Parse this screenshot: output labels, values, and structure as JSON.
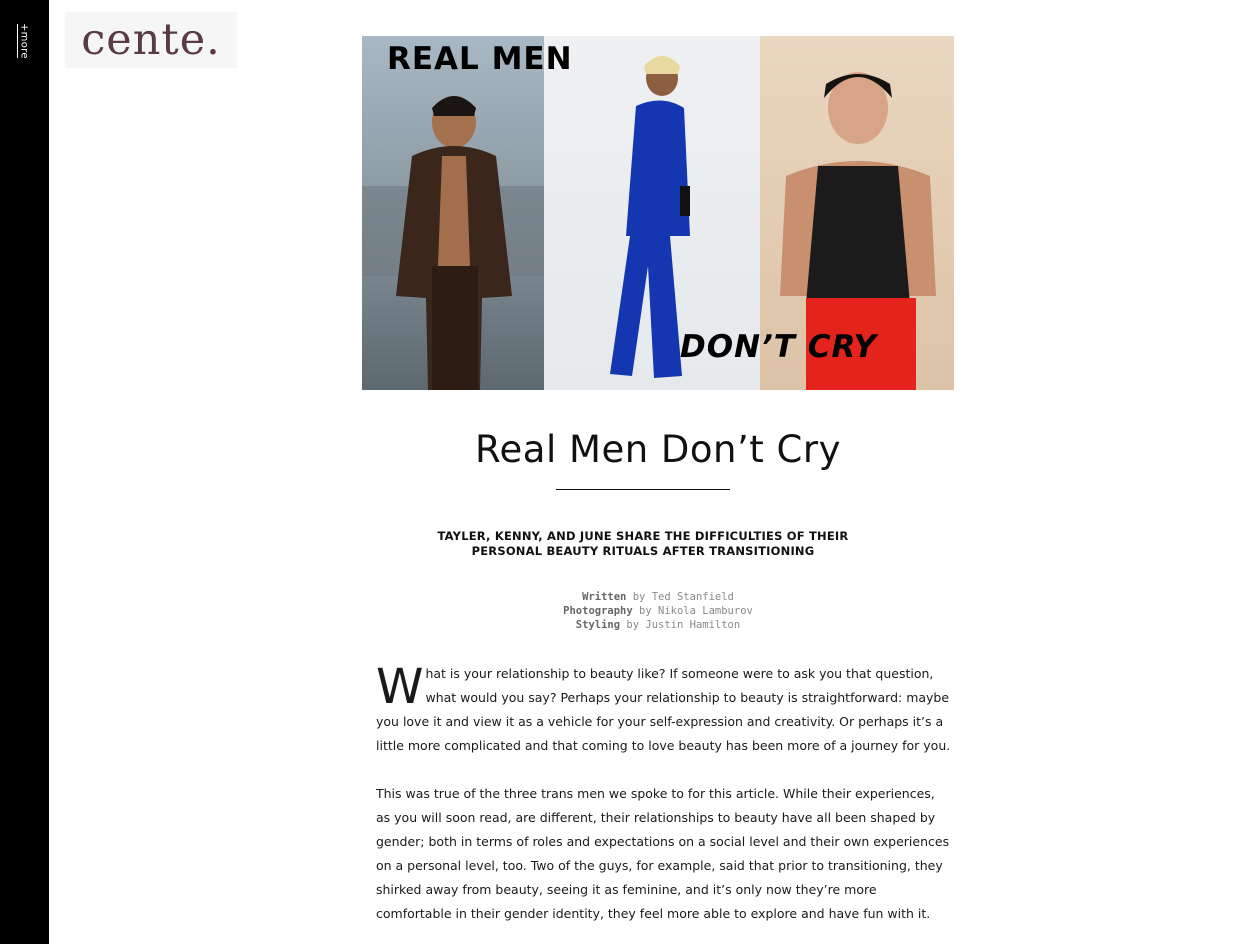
{
  "sidebar": {
    "more_label": "+more"
  },
  "logo": {
    "text": "cente."
  },
  "hero": {
    "headline_top": "REAL MEN",
    "headline_bottom": "DON’T CRY"
  },
  "article": {
    "title": "Real Men Don’t Cry",
    "subtitle_line1": "TAYLER, KENNY, AND JUNE SHARE THE DIFFICULTIES OF THEIR",
    "subtitle_line2": "PERSONAL BEAUTY RITUALS AFTER TRANSITIONING",
    "credits": [
      {
        "role": "Written",
        "sep": "by",
        "name": "Ted Stanfield"
      },
      {
        "role": "Photography",
        "sep": "by",
        "name": "Nikola Lamburov"
      },
      {
        "role": "Styling",
        "sep": "by",
        "name": "Justin Hamilton"
      }
    ],
    "dropcap": "W",
    "paragraph1": "hat is your relationship to beauty like? If someone were to ask you that question, what would you say? Perhaps your relationship to beauty is straightforward: maybe you love it and view it as a vehicle for your self-expression and creativity. Or perhaps it’s a little more complicated and that coming to love beauty has been more of a journey for you.",
    "paragraph2": "This was true of the three trans men we spoke to for this article. While their experiences, as you will soon read, are different, their relationships to beauty have all been shaped by gender; both in terms of roles and expectations on a social level and their own experiences on a personal level, too. Two of the guys, for example, said that prior to transitioning, they shirked away from beauty, seeing it as feminine, and it’s only now they’re more comfortable in their gender identity, they feel more able to explore and have fun with it."
  }
}
